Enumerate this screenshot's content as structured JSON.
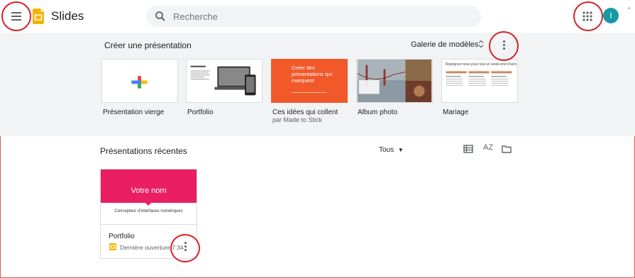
{
  "header": {
    "app_title": "Slides",
    "search_placeholder": "Recherche",
    "avatar_initial": "I"
  },
  "gallery": {
    "title": "Créer une présentation",
    "gallery_link": "Galerie de modèles",
    "templates": [
      {
        "label": "Présentation vierge",
        "sub": ""
      },
      {
        "label": "Portfolio",
        "sub": ""
      },
      {
        "label": "Ces idées qui collent",
        "sub": "par Made to Stick"
      },
      {
        "label": "Album photo",
        "sub": ""
      },
      {
        "label": "Mariage",
        "sub": ""
      }
    ],
    "idea_thumb_text": "Créer des présentations qui marquent",
    "wedding_thumb_text": "Rejoignez-nous pour tout un week-end d'activités !"
  },
  "recent": {
    "title": "Présentations récentes",
    "owner_filter": "Tous",
    "sort_label": "AZ",
    "doc": {
      "thumb_title": "Votre nom",
      "thumb_subtitle": "Concepteur d'interfaces numériques",
      "name": "Portfolio",
      "meta": "Dernière ouverture 7:34"
    }
  },
  "colors": {
    "accent_red": "#d9202a",
    "slides_yellow": "#f4b400",
    "doc_pink": "#e91e63",
    "idea_orange": "#f1592a",
    "avatar_teal": "#159aa5"
  }
}
